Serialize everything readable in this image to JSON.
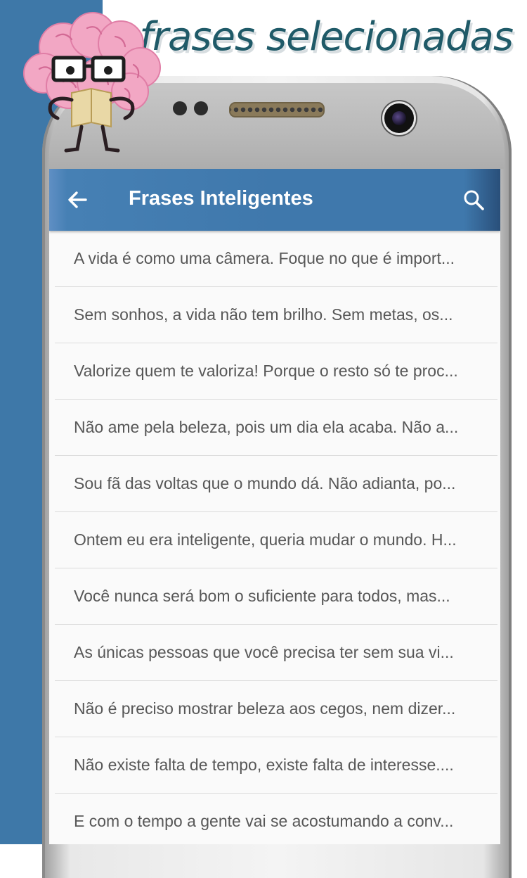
{
  "headline": "frases selecionadas",
  "app": {
    "title": "Frases Inteligentes",
    "back_icon": "arrow-left-icon",
    "search_icon": "search-icon"
  },
  "colors": {
    "band": "#3e78a8",
    "appbar": "#3f78ac",
    "headline": "#1f5a68",
    "item_text": "#575757"
  },
  "phrases": [
    "A vida é como uma câmera. Foque no que é import...",
    "Sem sonhos, a vida não tem brilho. Sem metas, os...",
    "Valorize quem te valoriza! Porque o resto só te proc...",
    "Não ame pela beleza, pois um dia ela acaba. Não a...",
    "Sou fã das voltas que o mundo dá. Não adianta, po...",
    "Ontem eu era inteligente, queria mudar o mundo. H...",
    "Você nunca será bom o suficiente para todos, mas...",
    "As únicas pessoas que você precisa ter sem sua vi...",
    "Não é preciso mostrar beleza aos cegos, nem dizer...",
    "Não existe falta de tempo, existe falta de interesse....",
    "E com o tempo a gente vai se acostumando a conv..."
  ]
}
